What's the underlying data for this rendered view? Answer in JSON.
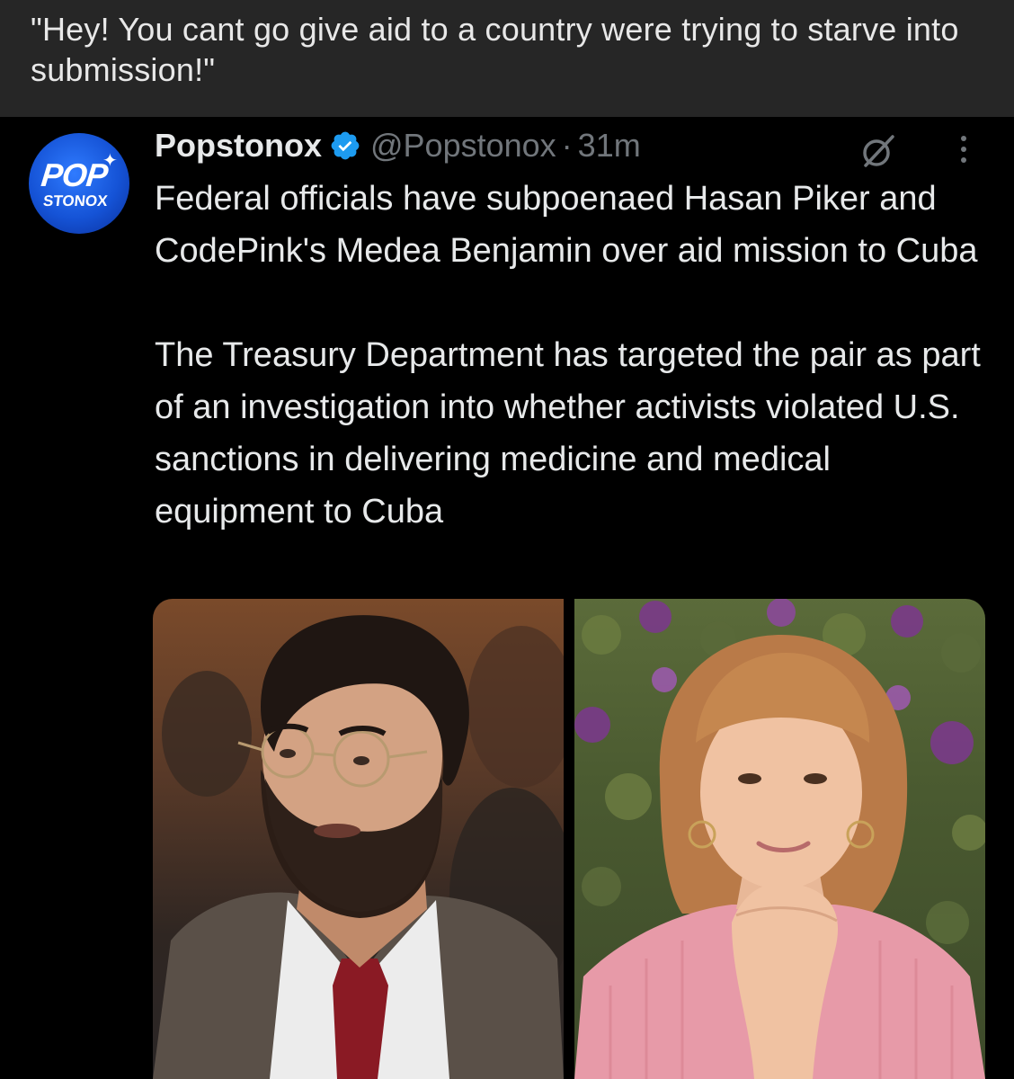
{
  "caption": {
    "text": "\"Hey! You cant go give aid to a country were trying to starve into submission!\""
  },
  "tweet": {
    "avatar": {
      "line1": "POP",
      "line2": "STONOX"
    },
    "display_name": "Popstonox",
    "handle": "@Popstonox",
    "separator": "·",
    "timestamp": "31m",
    "paragraphs": [
      "Federal officials have subpoenaed Hasan Piker and CodePink's Medea Benjamin over aid mission to Cuba",
      "The Treasury Department has targeted the pair as part of an investigation into whether activists violated U.S. sanctions in delivering medicine and medical equipment to Cuba"
    ],
    "icons": {
      "verified": "verified-badge-icon",
      "grok": "grok-icon",
      "more": "more-options-icon"
    },
    "colors": {
      "verified": "#1d9bf0",
      "secondary_text": "#71767b",
      "primary_text": "#e7e9ea",
      "caption_bar": "#262626"
    }
  }
}
